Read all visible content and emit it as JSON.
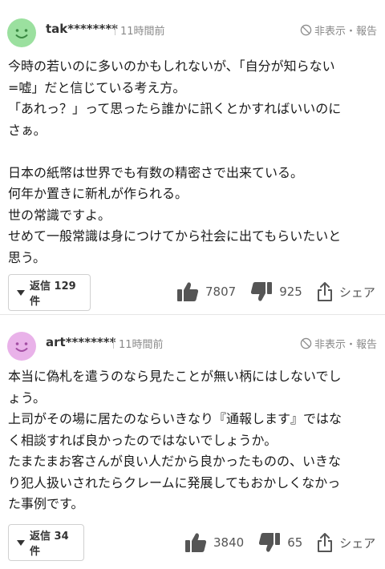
{
  "comments": [
    {
      "username": "tak********",
      "time": "11時間前",
      "report": "非表示・報告",
      "avatar_color": "#9be09f",
      "lines": [
        "今時の若いのに多いのかもしれないが、「自分が知らない",
        "=嘘」だと信じている考え方。",
        "「あれっ？」って思ったら誰かに訊くとかすればいいのに",
        "さぁ。",
        "",
        "日本の紙幣は世界でも有数の精密さで出来ている。",
        "何年か置きに新札が作られる。",
        "世の常識ですよ。",
        "せめて一般常識は身につけてから社会に出てもらいたいと",
        "思う。"
      ],
      "reply_label": "返信 129件",
      "likes": "7807",
      "dislikes": "925",
      "share": "シェア"
    },
    {
      "username": "art********",
      "time": "11時間前",
      "report": "非表示・報告",
      "avatar_color": "#e9b2e9",
      "lines": [
        "本当に偽札を遣うのなら見たことが無い柄にはしないでし",
        "ょう。",
        "上司がその場に居たのならいきなり『通報します』ではな",
        "く相談すれば良かったのではないでしょうか。",
        "たまたまお客さんが良い人だから良かったものの、いきな",
        "り犯人扱いされたらクレームに発展してもおかしくなかっ",
        "た事例です。"
      ],
      "reply_label": "返信 34件",
      "likes": "3840",
      "dislikes": "65",
      "share": "シェア"
    }
  ]
}
